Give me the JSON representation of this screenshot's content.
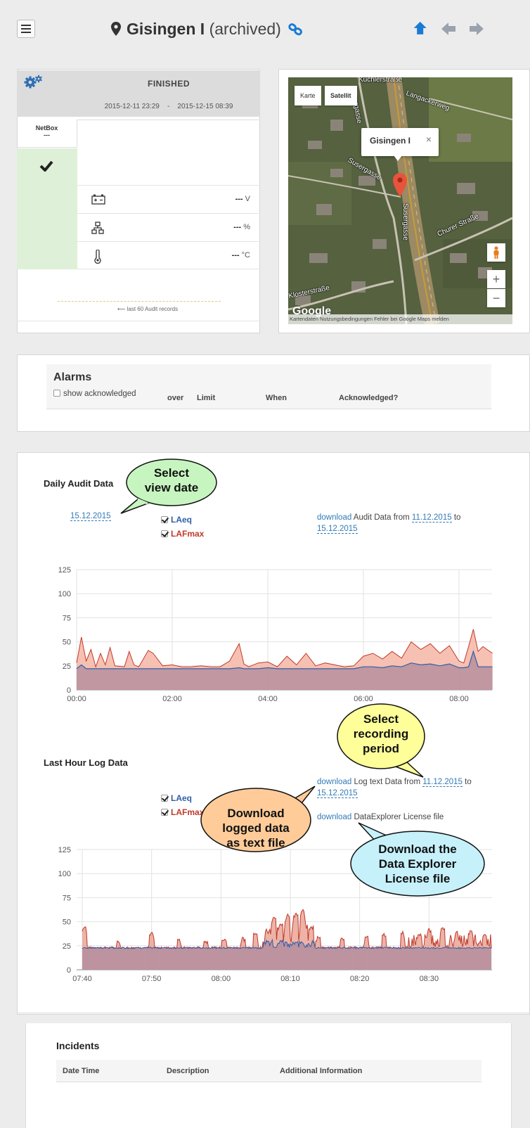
{
  "header": {
    "title": "Gisingen I",
    "status": "(archived)"
  },
  "status_panel": {
    "state": "FINISHED",
    "date_from": "2015-12-11 23:29",
    "date_sep": "-",
    "date_to": "2015-12-15 08:39",
    "device_label": "NetBox",
    "device_value": "---",
    "battery_value": "---",
    "battery_unit": "V",
    "network_value": "---",
    "network_unit": "%",
    "temp_value": "---",
    "temp_unit": "°C",
    "audit_link": "⟵ last 60 Audit records"
  },
  "map": {
    "tab_map": "Karte",
    "tab_satellite": "Satellit",
    "popup_title": "Gisingen I",
    "popup_close": "×",
    "street_labels": [
      "Langackerweg",
      "Susergasse",
      "Susergasse",
      "Churer Straße",
      "Klosterstraße",
      "Küchlerstraße",
      "Susergasse"
    ],
    "google_logo": "Google",
    "footer": "Kartendaten  Nutzungsbedingungen  Fehler bei Google Maps melden",
    "zoom_in": "+",
    "zoom_out": "−"
  },
  "alarms": {
    "title": "Alarms",
    "show_ack": "show acknowledged",
    "columns": [
      "over",
      "Limit",
      "When",
      "Acknowledged?"
    ]
  },
  "daily": {
    "title": "Daily Audit Data",
    "view_date": "15.12.2015",
    "legend_laeq": "LAeq",
    "legend_lafmax": "LAFmax",
    "download_link": "download",
    "download_text": "Audit Data from",
    "date_from": "11.12.2015",
    "to_word": "to",
    "date_to": "15.12.2015"
  },
  "lasthour": {
    "title": "Last Hour Log Data",
    "legend_laeq": "LAeq",
    "legend_lafmax": "LAFmax",
    "download_link": "download",
    "download_text": "Log text Data from",
    "date_from": "11.12.2015",
    "to_word": "to",
    "date_to": "15.12.2015",
    "license_link": "download",
    "license_text": "DataExplorer License file"
  },
  "callouts": {
    "select_view_date": [
      "Select",
      "view date"
    ],
    "select_recording": [
      "Select",
      "recording",
      "period"
    ],
    "download_text_file": [
      "Download",
      "logged data",
      "as text file"
    ],
    "download_license": [
      "Download the",
      "Data Explorer",
      "License file"
    ]
  },
  "incidents": {
    "title": "Incidents",
    "columns": [
      "Date Time",
      "Description",
      "Additional Information"
    ]
  },
  "colors": {
    "laeq": "#2f5fa8",
    "lafmax": "#c0392b",
    "accent": "#1a7bd4"
  },
  "chart_data": [
    {
      "type": "area",
      "ylim": [
        0,
        125
      ],
      "yticks": [
        "0",
        "25",
        "50",
        "75",
        "100",
        "125"
      ],
      "xticks": [
        "00:00",
        "02:00",
        "04:00",
        "06:00",
        "08:00"
      ],
      "x_hours": [
        0,
        0.1,
        0.2,
        0.3,
        0.4,
        0.5,
        0.6,
        0.7,
        0.8,
        1.0,
        1.1,
        1.2,
        1.3,
        1.5,
        1.6,
        1.8,
        2.0,
        2.2,
        2.4,
        2.6,
        2.8,
        3.0,
        3.2,
        3.4,
        3.5,
        3.6,
        3.8,
        4.0,
        4.2,
        4.4,
        4.6,
        4.8,
        5.0,
        5.2,
        5.4,
        5.6,
        5.8,
        6.0,
        6.2,
        6.4,
        6.6,
        6.8,
        7.0,
        7.2,
        7.4,
        7.6,
        7.8,
        8.0,
        8.1,
        8.2,
        8.3,
        8.4,
        8.5,
        8.7
      ],
      "series": [
        {
          "name": "LAFmax",
          "values": [
            28,
            55,
            30,
            42,
            24,
            38,
            26,
            44,
            25,
            24,
            40,
            26,
            24,
            41,
            38,
            25,
            26,
            24,
            24,
            25,
            24,
            24,
            30,
            48,
            27,
            24,
            28,
            29,
            24,
            35,
            26,
            38,
            25,
            28,
            26,
            24,
            25,
            35,
            38,
            32,
            40,
            33,
            50,
            42,
            48,
            38,
            46,
            30,
            28,
            45,
            63,
            40,
            45,
            38
          ]
        },
        {
          "name": "LAeq",
          "values": [
            22,
            26,
            22,
            22,
            22,
            22,
            22,
            22,
            22,
            22,
            22,
            22,
            22,
            22,
            22,
            22,
            22,
            22,
            22,
            22,
            22,
            22,
            22,
            23,
            22,
            22,
            22,
            23,
            22,
            22,
            22,
            22,
            22,
            22,
            22,
            22,
            22,
            24,
            24,
            23,
            25,
            24,
            28,
            26,
            27,
            25,
            27,
            23,
            23,
            24,
            40,
            24,
            24,
            24
          ]
        }
      ]
    },
    {
      "type": "area",
      "ylim": [
        0,
        125
      ],
      "yticks": [
        "0",
        "25",
        "50",
        "75",
        "100",
        "125"
      ],
      "xticks": [
        "07:40",
        "07:50",
        "08:00",
        "08:10",
        "08:20",
        "08:30"
      ],
      "x_start_min": 0,
      "x_end_min": 59,
      "series": [
        {
          "name": "LAFmax",
          "baseline": 23,
          "spikes": [
            [
              0.3,
              45
            ],
            [
              5.2,
              30
            ],
            [
              10,
              40
            ],
            [
              14,
              32
            ],
            [
              17.8,
              30
            ],
            [
              20.5,
              32
            ],
            [
              23.2,
              34
            ],
            [
              25,
              38
            ],
            [
              26.6,
              40
            ],
            [
              27.6,
              55
            ],
            [
              28.6,
              48
            ],
            [
              29.6,
              58
            ],
            [
              30.8,
              60
            ],
            [
              31.8,
              63
            ],
            [
              33,
              45
            ],
            [
              34,
              35
            ],
            [
              37.5,
              33
            ],
            [
              41,
              35
            ],
            [
              43.5,
              38
            ],
            [
              46.2,
              40
            ],
            [
              48.5,
              38
            ],
            [
              50,
              43
            ],
            [
              52,
              44
            ],
            [
              54,
              40
            ],
            [
              56,
              41
            ],
            [
              58,
              37
            ]
          ]
        },
        {
          "name": "LAeq",
          "baseline": 22
        }
      ]
    }
  ]
}
